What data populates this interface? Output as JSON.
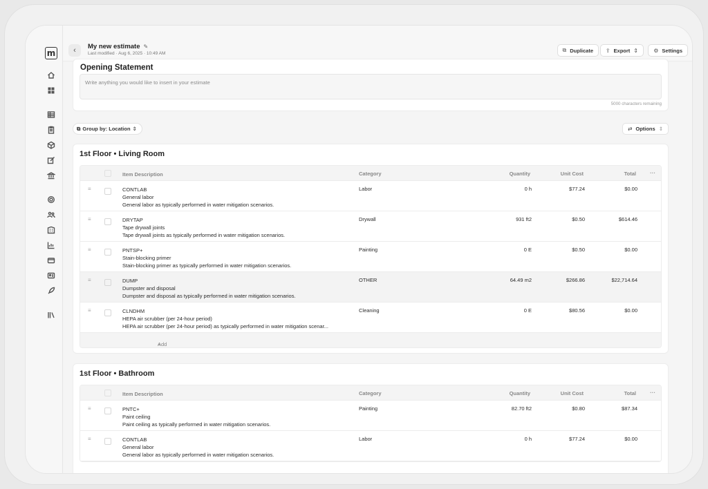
{
  "brand": {
    "logo_letter": "m"
  },
  "sidebar": {
    "items": [
      {
        "name": "home-icon"
      },
      {
        "name": "dashboard-icon"
      },
      {
        "name": "table-icon"
      },
      {
        "name": "clipboard-icon"
      },
      {
        "name": "box-icon"
      },
      {
        "name": "edit-icon"
      },
      {
        "name": "bank-icon"
      },
      {
        "name": "gear-icon"
      },
      {
        "name": "team-icon"
      },
      {
        "name": "building-icon"
      },
      {
        "name": "chart-icon"
      },
      {
        "name": "card-icon"
      },
      {
        "name": "id-card-icon"
      },
      {
        "name": "rocket-icon"
      },
      {
        "name": "library-icon"
      }
    ]
  },
  "header": {
    "back_icon": "‹",
    "title": "My new estimate",
    "last_modified": "Last modified · Aug 6, 2025 · 10:49 AM",
    "buttons": {
      "duplicate": "Duplicate",
      "export": "Export",
      "settings": "Settings"
    }
  },
  "opening": {
    "title": "Opening Statement",
    "placeholder": "Write anything you would like to insert in your estimate",
    "chars_remaining": "5000 characters remaining"
  },
  "toolbar": {
    "group_by": "Group by: Location",
    "options": "Options"
  },
  "columns": {
    "description": "Item Description",
    "category": "Category",
    "quantity": "Quantity",
    "unit_cost": "Unit Cost",
    "total": "Total",
    "more": "···"
  },
  "sections": [
    {
      "title": "1st Floor • Living Room",
      "add_label": "Add",
      "rows": [
        {
          "code": "CONTLAB",
          "name": "General labor",
          "detail": "General labor as typically performed in water mitigation scenarios.",
          "category": "Labor",
          "quantity": "0 h",
          "unit_cost": "$77.24",
          "total": "$0.00"
        },
        {
          "code": "DRYTAP",
          "name": "Tape drywall joints",
          "detail": "Tape drywall joints as typically performed in water mitigation scenarios.",
          "category": "Drywall",
          "quantity": "931 ft2",
          "unit_cost": "$0.50",
          "total": "$614.46"
        },
        {
          "code": "PNTSP+",
          "name": "Stain-blocking primer",
          "detail": "Stain-blocking primer as typically performed in water mitigation scenarios.",
          "category": "Painting",
          "quantity": "0 E",
          "unit_cost": "$0.50",
          "total": "$0.00"
        },
        {
          "code": "DUMP",
          "name": "Dumpster and disposal",
          "detail": "Dumpster and disposal as typically performed in water mitigation scenarios.",
          "category": "OTHER",
          "quantity": "64.49 m2",
          "unit_cost": "$266.86",
          "total": "$22,714.64"
        },
        {
          "code": "CLNDHM",
          "name": "HEPA air scrubber (per 24-hour period)",
          "detail": "HEPA air scrubber (per 24-hour period) as typically performed in water mitigation scenar...",
          "category": "Cleaning",
          "quantity": "0 E",
          "unit_cost": "$80.56",
          "total": "$0.00"
        }
      ]
    },
    {
      "title": "1st Floor • Bathroom",
      "rows": [
        {
          "code": "PNTC+",
          "name": "Paint ceiling",
          "detail": "Paint ceiling as typically performed in water mitigation scenarios.",
          "category": "Painting",
          "quantity": "82.70 ft2",
          "unit_cost": "$0.80",
          "total": "$87.34"
        },
        {
          "code": "CONTLAB",
          "name": "General labor",
          "detail": "General labor as typically performed in water mitigation scenarios.",
          "category": "Labor",
          "quantity": "0 h",
          "unit_cost": "$77.24",
          "total": "$0.00"
        }
      ]
    }
  ]
}
